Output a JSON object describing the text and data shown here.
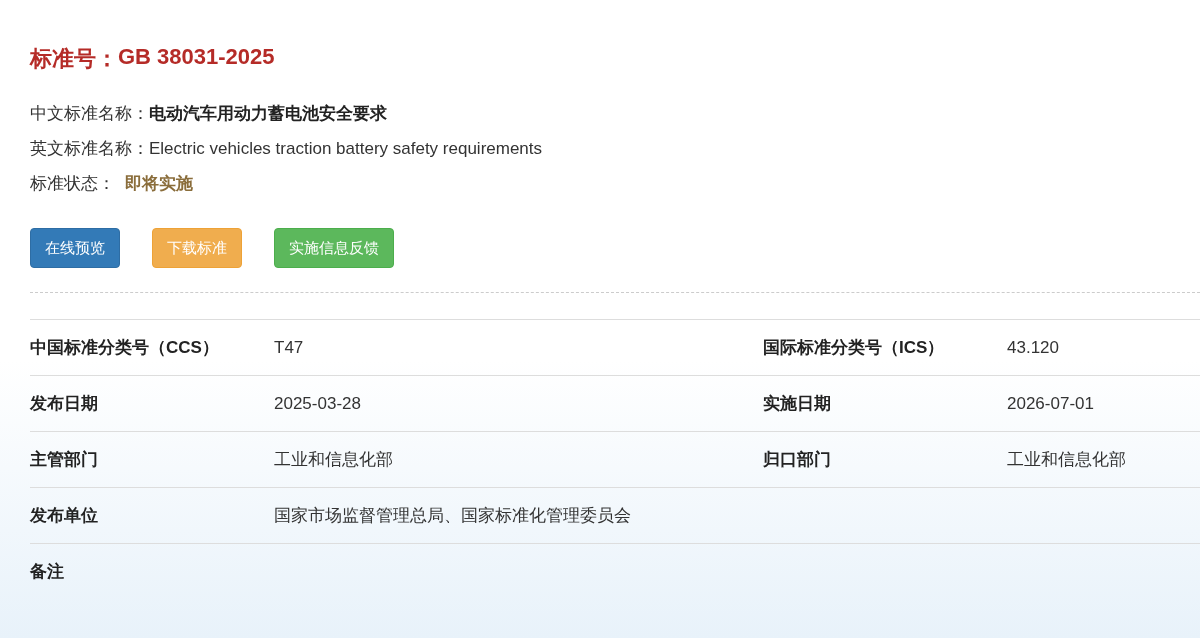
{
  "title": {
    "label": "标准号：",
    "value": "GB 38031-2025"
  },
  "info": [
    {
      "label": "中文标准名称：",
      "value": "电动汽车用动力蓄电池安全要求",
      "kind": "bold"
    },
    {
      "label": "英文标准名称：",
      "value": "Electric vehicles traction battery safety requirements",
      "kind": "plain"
    },
    {
      "label": "标准状态：",
      "value": "即将实施",
      "kind": "status"
    }
  ],
  "buttons": [
    {
      "label": "在线预览",
      "kind": "primary"
    },
    {
      "label": "下载标准",
      "kind": "warning"
    },
    {
      "label": "实施信息反馈",
      "kind": "success"
    }
  ],
  "table": {
    "rows": [
      {
        "cells": [
          "中国标准分类号（CCS）",
          "T47",
          "国际标准分类号（ICS）",
          "43.120"
        ]
      },
      {
        "cells": [
          "发布日期",
          "2025-03-28",
          "实施日期",
          "2026-07-01"
        ]
      },
      {
        "cells": [
          "主管部门",
          "工业和信息化部",
          "归口部门",
          "工业和信息化部"
        ]
      },
      {
        "cells": [
          "发布单位",
          "国家市场监督管理总局、国家标准化管理委员会"
        ]
      },
      {
        "cells": [
          "备注"
        ]
      }
    ]
  }
}
